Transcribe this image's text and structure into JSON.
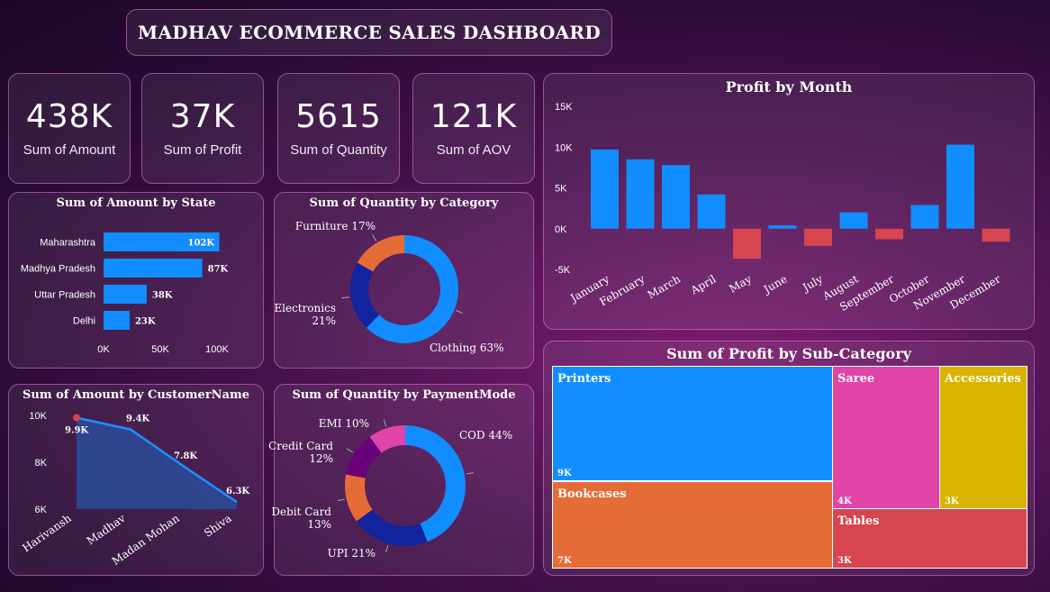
{
  "header": {
    "title": "MADHAV ECOMMERCE SALES DASHBOARD"
  },
  "kpis": [
    {
      "value": "438K",
      "label": "Sum of Amount"
    },
    {
      "value": "37K",
      "label": "Sum of Profit"
    },
    {
      "value": "5615",
      "label": "Sum of Quantity"
    },
    {
      "value": "121K",
      "label": "Sum of AOV"
    }
  ],
  "colors": {
    "blue": "#118dff",
    "negative": "#d64550",
    "orange": "#e66c37",
    "navy": "#12239e",
    "purple": "#6b007b",
    "pink": "#e044a7",
    "yellow": "#d9b300",
    "red": "#d64550",
    "customer_fill": "#2a4c9a",
    "customer_line": "#1e90ff"
  },
  "chart_data": [
    {
      "id": "state",
      "type": "bar",
      "orientation": "horizontal",
      "title": "Sum of Amount by State",
      "categories": [
        "Maharashtra",
        "Madhya Pradesh",
        "Uttar Pradesh",
        "Delhi"
      ],
      "values": [
        102,
        87,
        38,
        23
      ],
      "data_labels": [
        "102K",
        "87K",
        "38K",
        "23K"
      ],
      "xlim": [
        0,
        100
      ],
      "xticks": [
        "0K",
        "50K",
        "100K"
      ],
      "xtick_values": [
        0,
        50,
        100
      ]
    },
    {
      "id": "category",
      "type": "pie",
      "donut": true,
      "title": "Sum of Quantity by Category",
      "slices": [
        {
          "name": "Clothing",
          "value": 63,
          "label": "Clothing 63%",
          "color": "#118dff"
        },
        {
          "name": "Electronics",
          "value": 21,
          "label": "Electronics 21%",
          "color": "#12239e"
        },
        {
          "name": "Furniture",
          "value": 17,
          "label": "Furniture 17%",
          "color": "#e66c37"
        }
      ]
    },
    {
      "id": "customer",
      "type": "area",
      "title": "Sum of Amount by CustomerName",
      "categories": [
        "Harivansh",
        "Madhav",
        "Madan Mohan",
        "Shiva"
      ],
      "values": [
        9.9,
        9.4,
        7.8,
        6.3
      ],
      "data_labels": [
        "9.9K",
        "9.4K",
        "7.8K",
        "6.3K"
      ],
      "ylim": [
        6,
        10
      ],
      "yticks": [
        "6K",
        "8K",
        "10K"
      ],
      "ytick_values": [
        6,
        8,
        10
      ]
    },
    {
      "id": "payment",
      "type": "pie",
      "donut": true,
      "title": "Sum of Quantity by PaymentMode",
      "slices": [
        {
          "name": "COD",
          "value": 44,
          "label": "COD 44%",
          "color": "#118dff"
        },
        {
          "name": "UPI",
          "value": 21,
          "label": "UPI 21%",
          "color": "#12239e"
        },
        {
          "name": "Debit Card",
          "value": 13,
          "label": "Debit Card 13%",
          "color": "#e66c37"
        },
        {
          "name": "Credit Card",
          "value": 12,
          "label": "Credit Card 12%",
          "color": "#6b007b"
        },
        {
          "name": "EMI",
          "value": 10,
          "label": "EMI 10%",
          "color": "#e044a7"
        }
      ]
    },
    {
      "id": "month",
      "type": "bar",
      "title": "Profit by Month",
      "categories": [
        "January",
        "February",
        "March",
        "April",
        "May",
        "June",
        "July",
        "August",
        "September",
        "October",
        "November",
        "December"
      ],
      "values": [
        9.7,
        8.5,
        7.8,
        4.2,
        -3.7,
        0.4,
        -2.1,
        2.0,
        -1.3,
        2.9,
        10.3,
        -1.6
      ],
      "ylim": [
        -5,
        15
      ],
      "yticks": [
        "-5K",
        "0K",
        "5K",
        "10K",
        "15K"
      ],
      "ytick_values": [
        -5,
        0,
        5,
        10,
        15
      ]
    },
    {
      "id": "subcat",
      "type": "treemap",
      "title": "Sum of Profit by Sub-Category",
      "items": [
        {
          "name": "Printers",
          "value": 9,
          "label": "9K",
          "color": "#118dff"
        },
        {
          "name": "Bookcases",
          "value": 7,
          "label": "7K",
          "color": "#e66c37"
        },
        {
          "name": "Saree",
          "value": 4,
          "label": "4K",
          "color": "#e044a7"
        },
        {
          "name": "Accessories",
          "value": 3,
          "label": "3K",
          "color": "#d9b300"
        },
        {
          "name": "Tables",
          "value": 3,
          "label": "3K",
          "color": "#d64550"
        }
      ]
    }
  ]
}
